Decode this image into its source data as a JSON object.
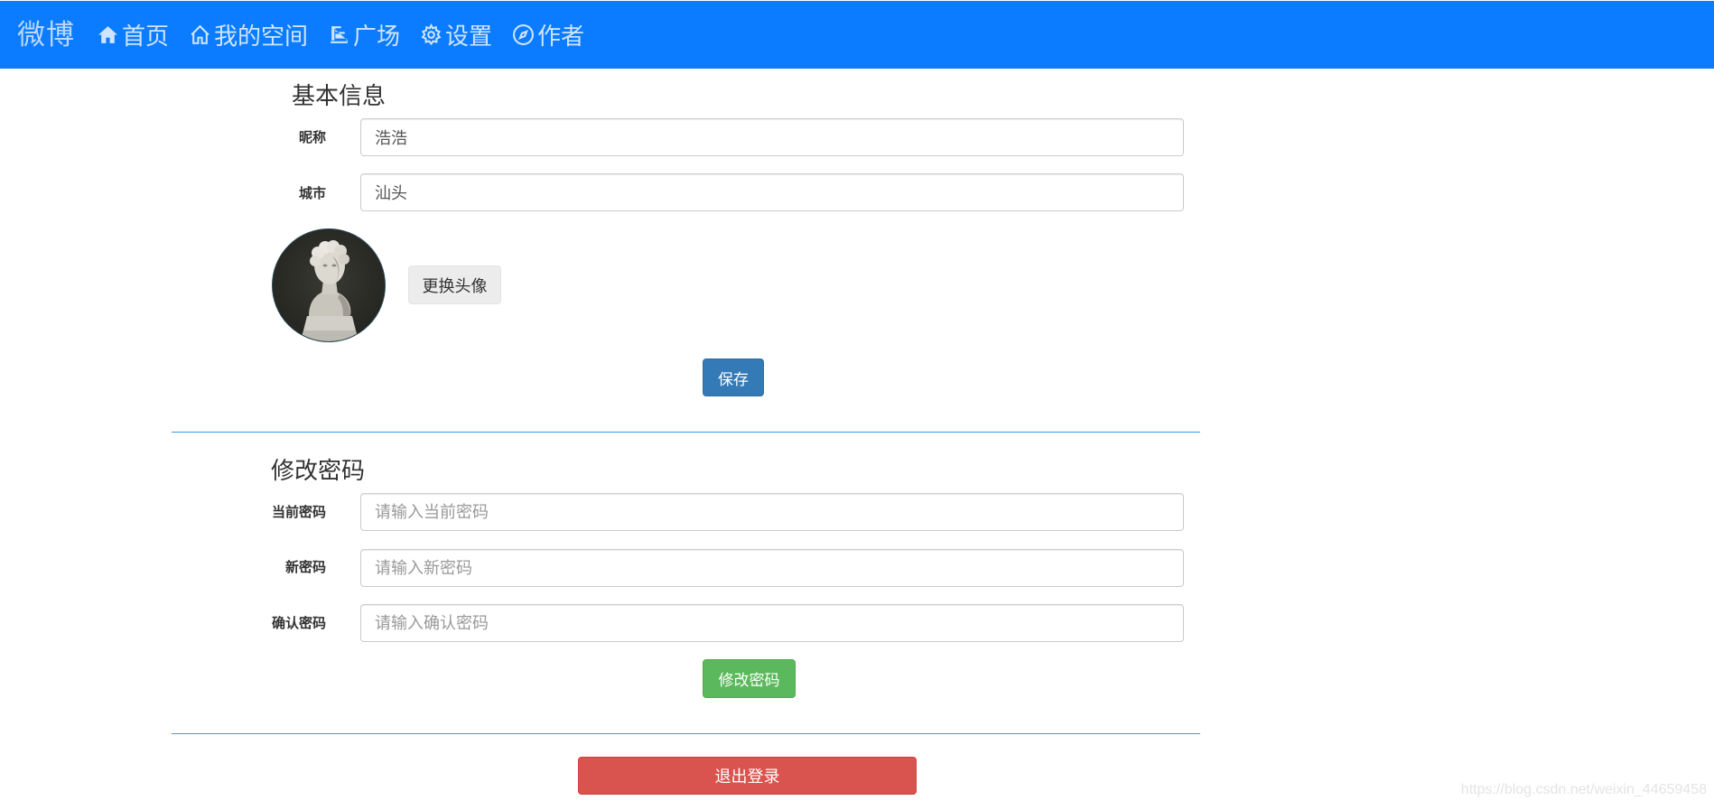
{
  "navbar": {
    "brand": "微博",
    "items": [
      {
        "label": "首页",
        "icon": "home-icon"
      },
      {
        "label": "我的空间",
        "icon": "house-outline-icon"
      },
      {
        "label": "广场",
        "icon": "plaza-icon"
      },
      {
        "label": "设置",
        "icon": "gear-icon"
      },
      {
        "label": "作者",
        "icon": "compass-icon"
      }
    ],
    "background_color": "#0b7cff"
  },
  "basic_info": {
    "title": "基本信息",
    "nickname_label": "昵称",
    "nickname_value": "浩浩",
    "city_label": "城市",
    "city_value": "汕头",
    "change_avatar_label": "更换头像",
    "save_label": "保存"
  },
  "password": {
    "title": "修改密码",
    "current_label": "当前密码",
    "current_placeholder": "请输入当前密码",
    "new_label": "新密码",
    "new_placeholder": "请输入新密码",
    "confirm_label": "确认密码",
    "confirm_placeholder": "请输入确认密码",
    "submit_label": "修改密码"
  },
  "logout_label": "退出登录",
  "watermark": "https://blog.csdn.net/weixin_44659458"
}
